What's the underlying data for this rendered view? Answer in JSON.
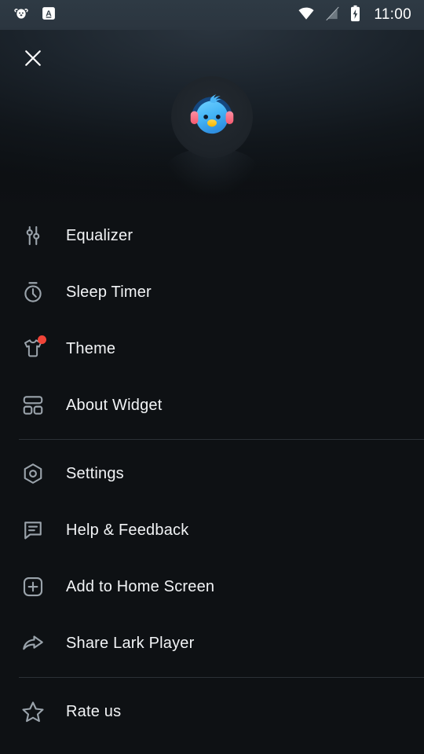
{
  "status_bar": {
    "notification_icons": [
      "dog-headphones-app-icon",
      "a-letter-app-icon"
    ],
    "wifi_icon": "wifi-icon",
    "signal_icon": "signal-off-icon",
    "battery_icon": "battery-charging-icon",
    "time": "11:00"
  },
  "header": {
    "close_icon": "close-icon",
    "logo_icon": "lark-player-bird-logo"
  },
  "menu": {
    "groups": [
      {
        "items": [
          {
            "icon": "equalizer-icon",
            "label": "Equalizer",
            "badge": false
          },
          {
            "icon": "sleep-timer-icon",
            "label": "Sleep Timer",
            "badge": false
          },
          {
            "icon": "theme-tshirt-icon",
            "label": "Theme",
            "badge": true
          },
          {
            "icon": "about-widget-icon",
            "label": "About Widget",
            "badge": false
          }
        ]
      },
      {
        "items": [
          {
            "icon": "settings-icon",
            "label": "Settings",
            "badge": false
          },
          {
            "icon": "help-feedback-icon",
            "label": "Help & Feedback",
            "badge": false
          },
          {
            "icon": "add-to-home-screen-icon",
            "label": "Add to Home Screen",
            "badge": false
          },
          {
            "icon": "share-icon",
            "label": "Share Lark Player",
            "badge": false
          }
        ]
      },
      {
        "items": [
          {
            "icon": "star-icon",
            "label": "Rate us",
            "badge": false
          }
        ]
      }
    ]
  },
  "colors": {
    "background": "#0e1114",
    "status_bar": "#2e3a44",
    "text_primary": "#f2f4f6",
    "icon_stroke": "#9aa3ab",
    "badge_red": "#f04438",
    "divider": "#2b3137",
    "logo_body": "#4cb5f5",
    "logo_headphone": "#f8778c",
    "logo_beak": "#ffc61e"
  }
}
